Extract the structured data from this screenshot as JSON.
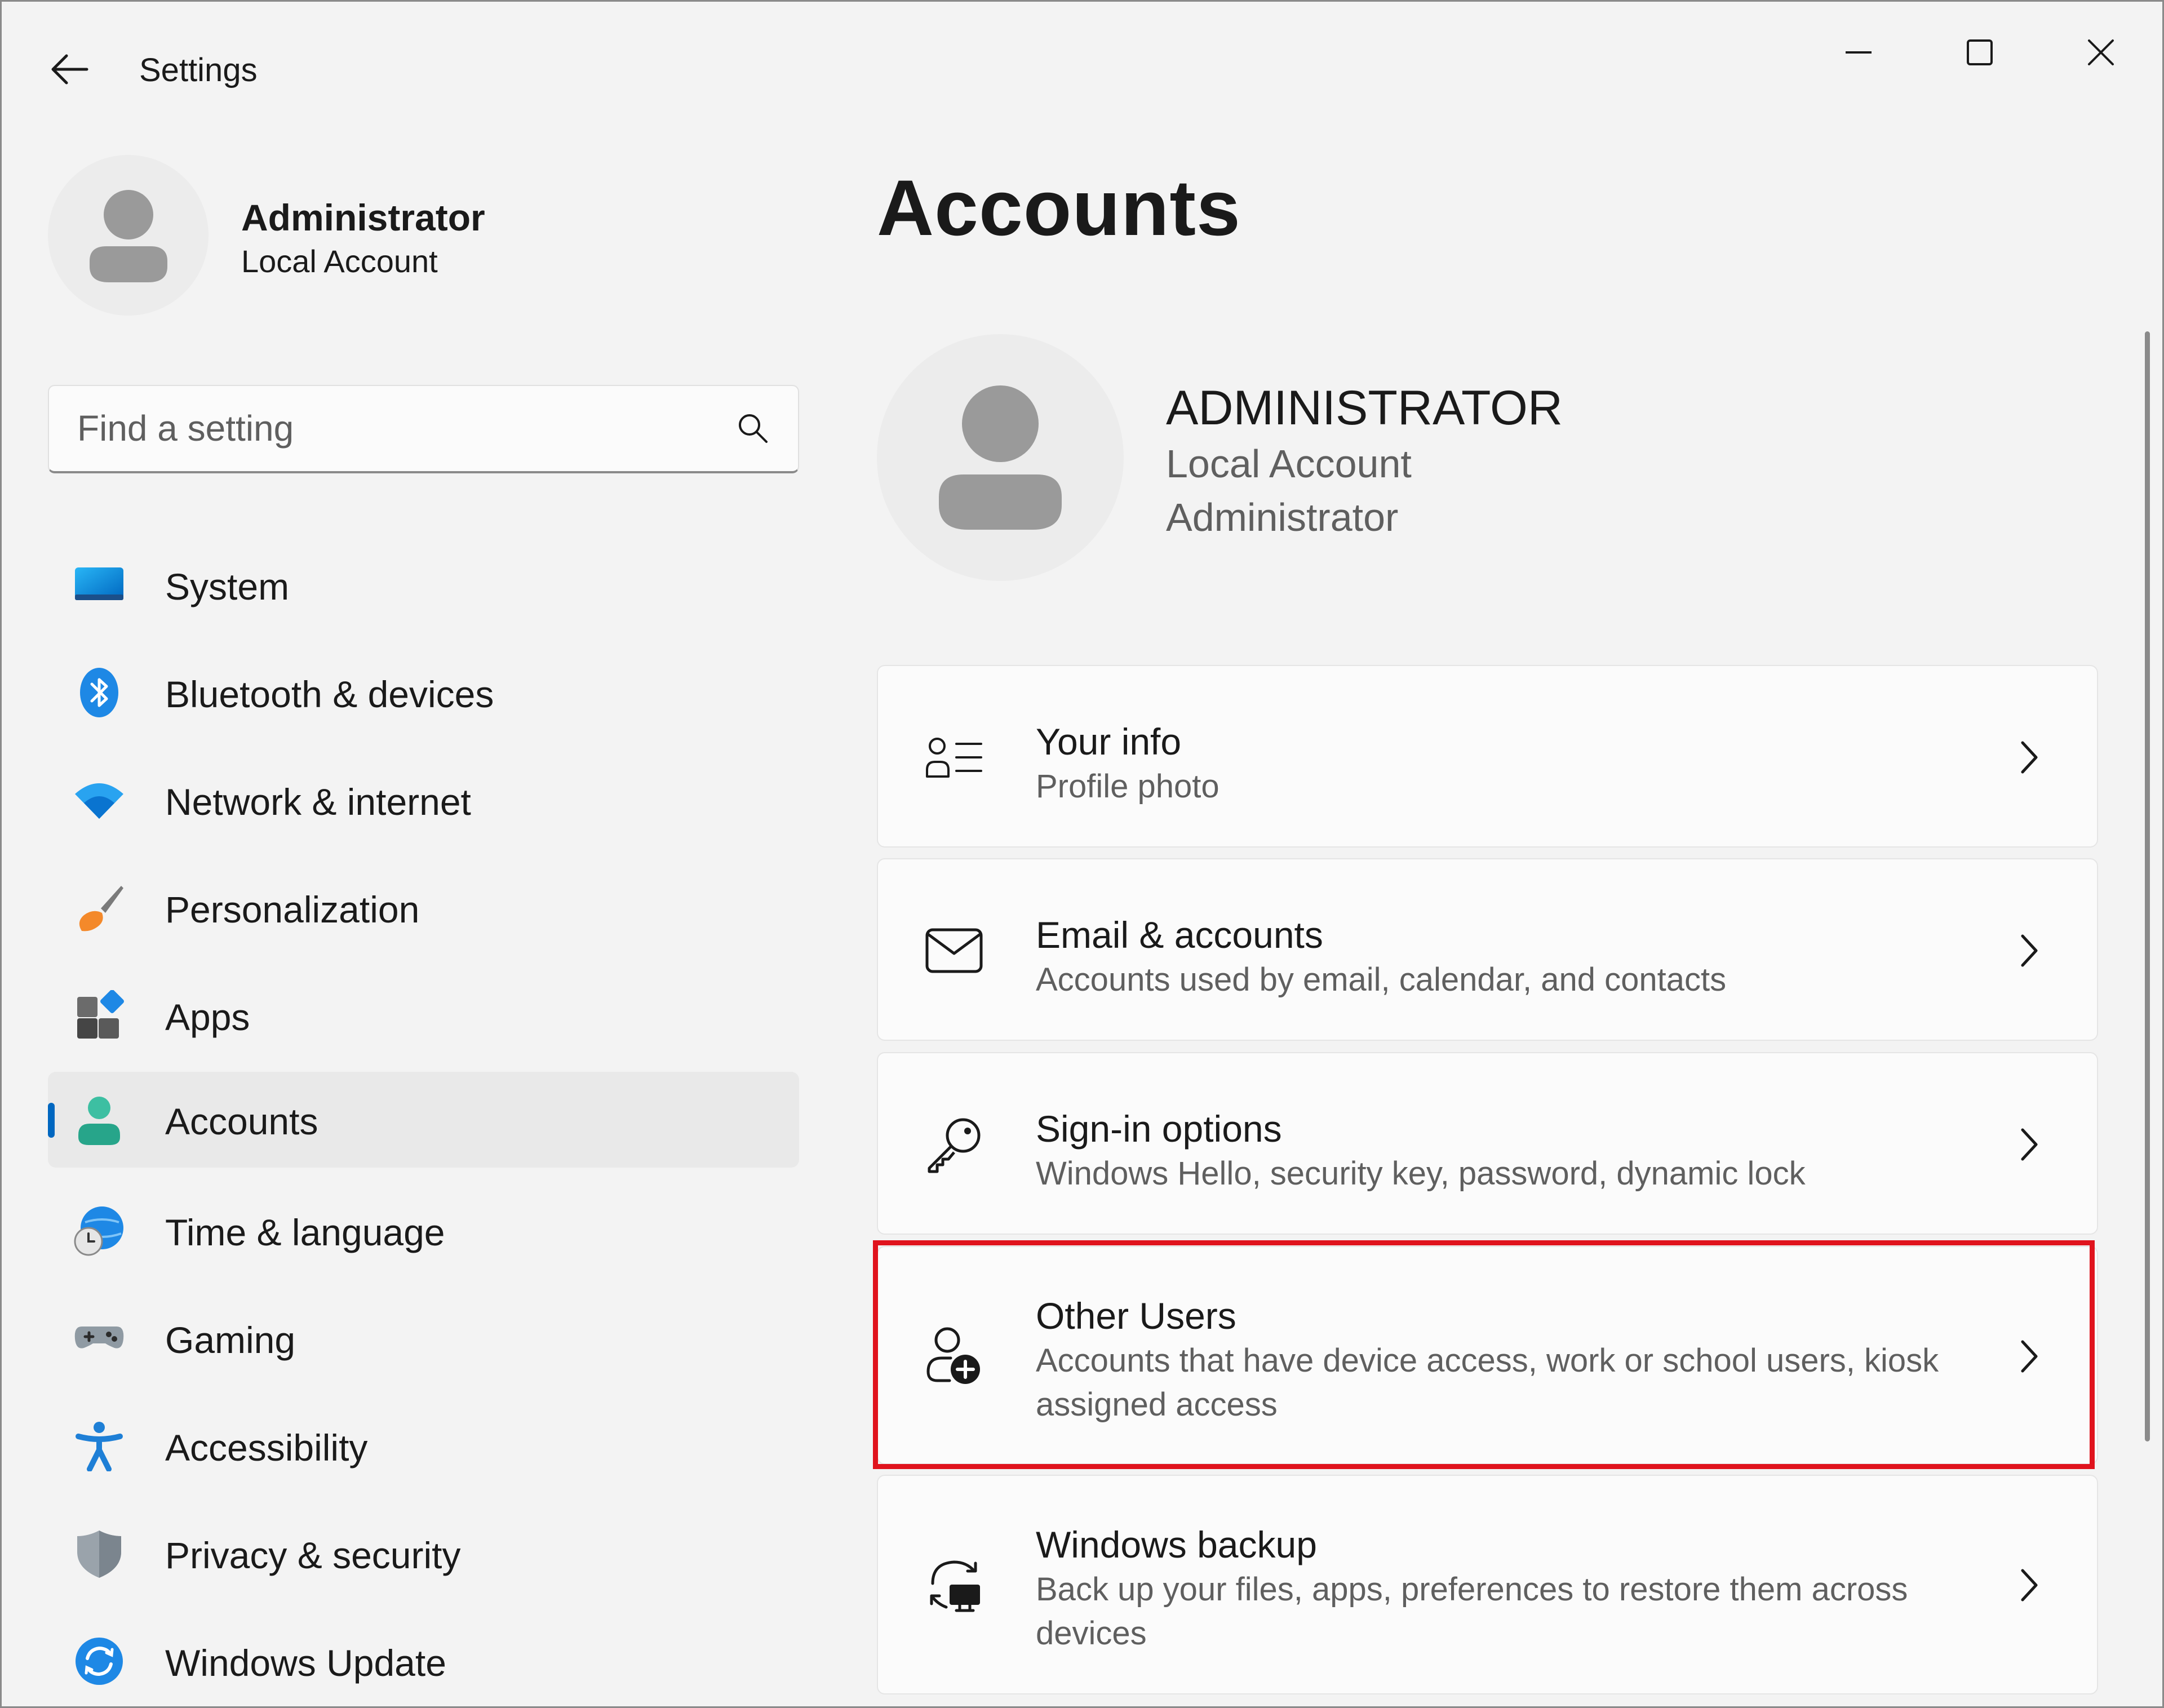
{
  "window": {
    "title": "Settings"
  },
  "profile": {
    "name": "Administrator",
    "account_type": "Local Account"
  },
  "search": {
    "placeholder": "Find a setting"
  },
  "nav": {
    "items": [
      {
        "label": "System",
        "icon": "system-icon",
        "active": false
      },
      {
        "label": "Bluetooth & devices",
        "icon": "bluetooth-icon",
        "active": false
      },
      {
        "label": "Network & internet",
        "icon": "wifi-icon",
        "active": false
      },
      {
        "label": "Personalization",
        "icon": "brush-icon",
        "active": false
      },
      {
        "label": "Apps",
        "icon": "apps-icon",
        "active": false
      },
      {
        "label": "Accounts",
        "icon": "accounts-icon",
        "active": true
      },
      {
        "label": "Time & language",
        "icon": "globe-clock-icon",
        "active": false
      },
      {
        "label": "Gaming",
        "icon": "gamepad-icon",
        "active": false
      },
      {
        "label": "Accessibility",
        "icon": "accessibility-icon",
        "active": false
      },
      {
        "label": "Privacy & security",
        "icon": "shield-icon",
        "active": false
      },
      {
        "label": "Windows Update",
        "icon": "update-icon",
        "active": false
      }
    ]
  },
  "main": {
    "title": "Accounts",
    "account": {
      "name": "ADMINISTRATOR",
      "line1": "Local Account",
      "line2": "Administrator"
    },
    "cards": [
      {
        "title": "Your info",
        "desc": "Profile photo",
        "icon": "user-info-icon"
      },
      {
        "title": "Email & accounts",
        "desc": "Accounts used by email, calendar, and contacts",
        "icon": "mail-icon"
      },
      {
        "title": "Sign-in options",
        "desc": "Windows Hello, security key, password, dynamic lock",
        "icon": "key-icon"
      },
      {
        "title": "Other Users",
        "desc": "Accounts that have device access, work or school users, kiosk assigned access",
        "icon": "add-user-icon",
        "highlighted": true
      },
      {
        "title": "Windows backup",
        "desc": "Back up your files, apps, preferences to restore them across devices",
        "icon": "backup-icon"
      }
    ]
  },
  "colors": {
    "accent": "#0067c0",
    "highlight": "#e0131d",
    "background": "#f3f3f3"
  }
}
